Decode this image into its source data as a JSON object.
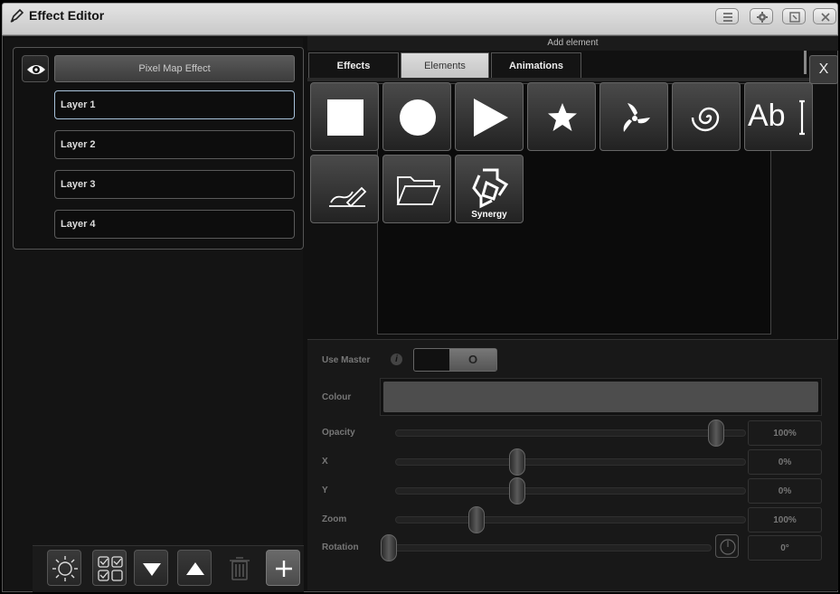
{
  "window": {
    "title": "Effect Editor"
  },
  "left": {
    "pixel_map_label": "Pixel Map Effect",
    "layers": [
      "Layer 1",
      "Layer 2",
      "Layer 3",
      "Layer 4"
    ],
    "selected_layer": "Layer 1"
  },
  "right": {
    "header": "Add element",
    "tabs": [
      {
        "label": "Effects",
        "active": false
      },
      {
        "label": "Elements",
        "active": true
      },
      {
        "label": "Animations",
        "active": false
      }
    ],
    "close_label": "X",
    "tiles": [
      {
        "name": "square",
        "label": ""
      },
      {
        "name": "circle",
        "label": ""
      },
      {
        "name": "triangle",
        "label": ""
      },
      {
        "name": "star",
        "label": ""
      },
      {
        "name": "pinwheel",
        "label": ""
      },
      {
        "name": "spiral",
        "label": ""
      },
      {
        "name": "text",
        "label": ""
      },
      {
        "name": "draw",
        "label": ""
      },
      {
        "name": "folder",
        "label": ""
      },
      {
        "name": "synergy",
        "label": "Synergy"
      }
    ],
    "text_tile_glyph": "Ab"
  },
  "props": {
    "use_master_label": "Use Master",
    "use_master_toggle_glyph": "O",
    "use_master_on": false,
    "colour_label": "Colour",
    "colour_value": "#4d4d4d",
    "opacity": {
      "label": "Opacity",
      "value": "100%",
      "fraction": 1.0
    },
    "x": {
      "label": "X",
      "value": "0%",
      "fraction": 0.34
    },
    "y": {
      "label": "Y",
      "value": "0%",
      "fraction": 0.34
    },
    "zoom": {
      "label": "Zoom",
      "value": "100%",
      "fraction": 0.22
    },
    "rotation": {
      "label": "Rotation",
      "value": "0°",
      "fraction": 0.0
    }
  },
  "colors": {
    "accent": "#a8c2da",
    "panel": "#141414"
  }
}
